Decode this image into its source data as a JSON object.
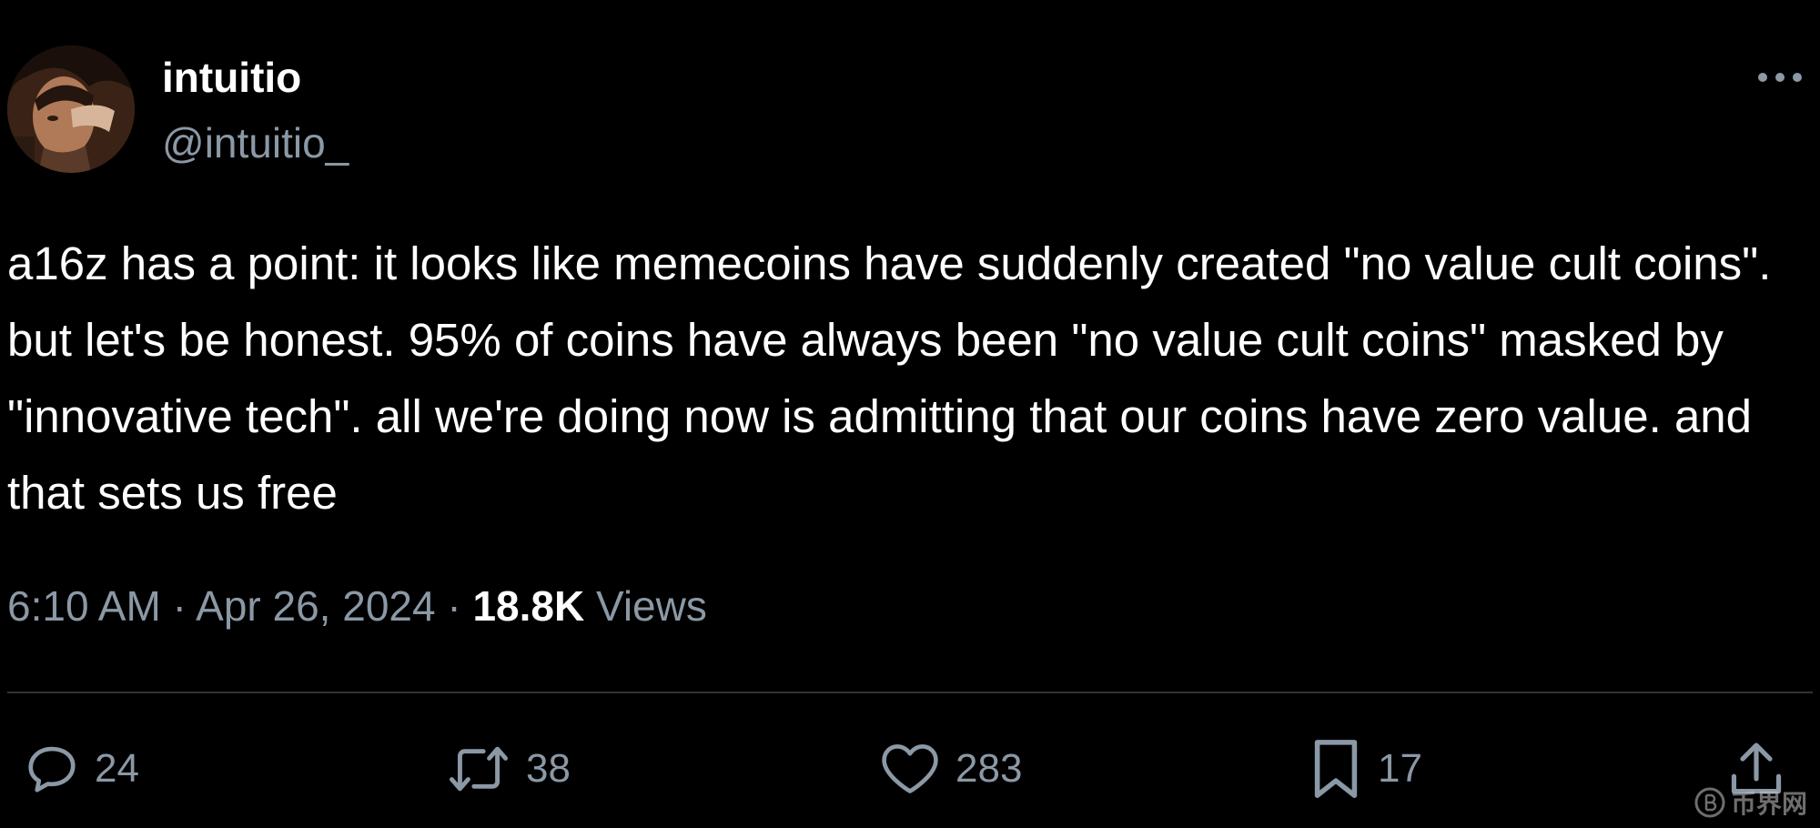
{
  "author": {
    "display_name": "intuitio",
    "handle": "@intuitio_"
  },
  "tweet": {
    "text": "a16z has a point: it looks like memecoins have suddenly created \"no value cult coins\". but let's be honest. 95% of coins have always been \"no value cult coins\" masked by \"innovative tech\". all we're doing now is admitting that our coins have zero value. and that sets us free",
    "time": "6:10 AM",
    "separator": "·",
    "date": "Apr 26, 2024",
    "views_count": "18.8K",
    "views_label": "Views"
  },
  "actions": {
    "replies": "24",
    "retweets": "38",
    "likes": "283",
    "bookmarks": "17"
  },
  "icons": {
    "more": "more-horizontal-icon",
    "reply": "reply-icon",
    "retweet": "retweet-icon",
    "like": "heart-icon",
    "bookmark": "bookmark-icon",
    "share": "share-icon"
  },
  "colors": {
    "background": "#000000",
    "primary_text": "#ffffff",
    "secondary_text": "#8b98a5",
    "divider": "#2f3336"
  },
  "watermark": {
    "text": "币界网"
  }
}
